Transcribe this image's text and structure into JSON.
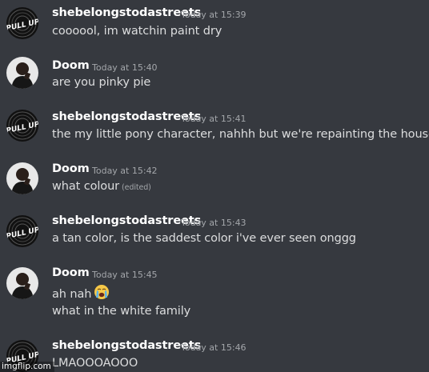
{
  "users": {
    "u1": {
      "name": "shebelongstodastreets",
      "avatar_text": "PULL UP"
    },
    "u2": {
      "name": "Doom"
    }
  },
  "messages": [
    {
      "author": "shebelongstodastreets",
      "time": "Today at 15:39",
      "lines": [
        "coooool, im watchin paint dry"
      ]
    },
    {
      "author": "Doom",
      "time": "Today at 15:40",
      "lines": [
        "are you pinky pie"
      ]
    },
    {
      "author": "shebelongstodastreets",
      "time": "Today at 15:41",
      "lines": [
        "the my little pony character, nahhh but we're repainting the house"
      ]
    },
    {
      "author": "Doom",
      "time": "Today at 15:42",
      "lines": [
        "what colour"
      ],
      "edited": "(edited)"
    },
    {
      "author": "shebelongstodastreets",
      "time": "Today at 15:43",
      "lines": [
        "a tan color, is the saddest color i've ever seen onggg"
      ]
    },
    {
      "author": "Doom",
      "time": "Today at 15:45",
      "lines": [
        "ah nah",
        "what in the white family"
      ],
      "emoji": "loudly-crying-face"
    },
    {
      "author": "shebelongstodastreets",
      "time": "Today at 15:46",
      "lines": [
        "LMAOOOAOOO"
      ]
    }
  ],
  "watermark": "imgflip.com",
  "colors": {
    "background": "#36393f",
    "username": "#ffffff",
    "text": "#dcddde",
    "timestamp": "#a3a6aa"
  }
}
